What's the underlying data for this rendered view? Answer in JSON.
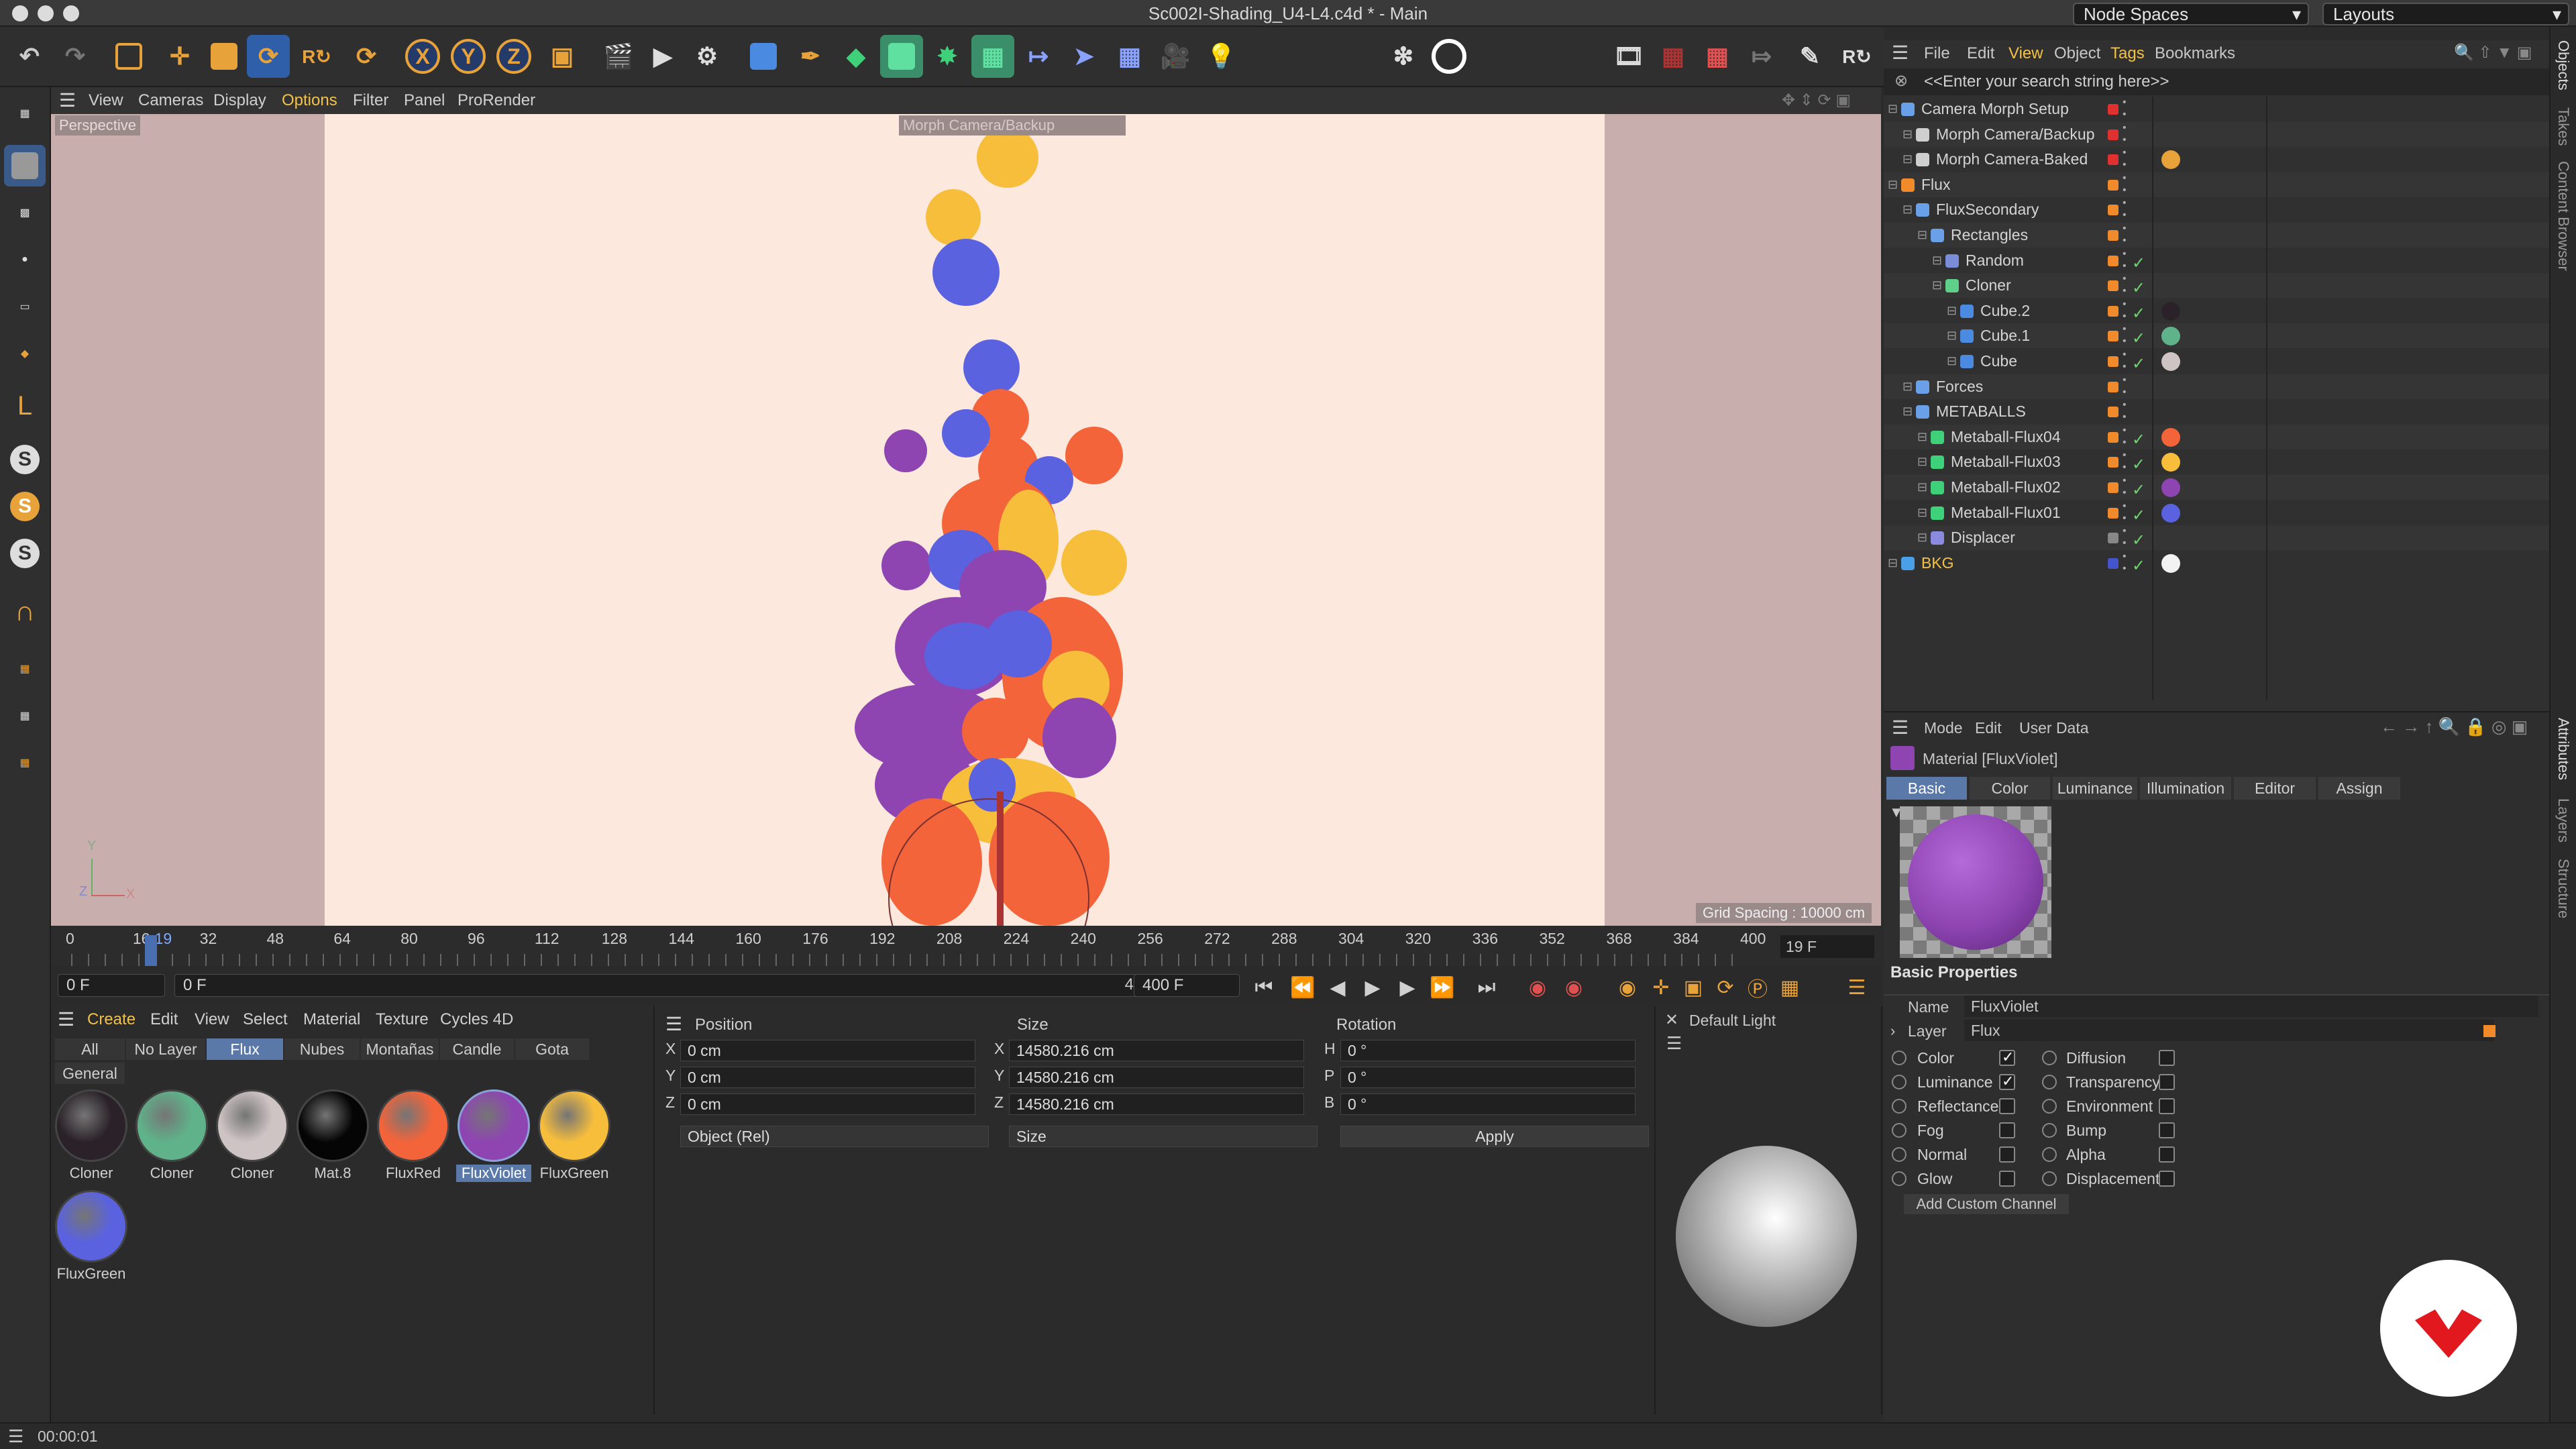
{
  "app": {
    "title": "Sc002I-Shading_U4-L4.c4d * - Main",
    "node_spaces": "Node Spaces",
    "layouts": "Layouts"
  },
  "viewport": {
    "menu": [
      "View",
      "Cameras",
      "Display",
      "Options",
      "Filter",
      "Panel",
      "ProRender"
    ],
    "active_menu": "Options",
    "label": "Perspective",
    "camera": "Morph Camera/Backup",
    "grid_spacing": "Grid Spacing : 10000 cm",
    "axis_x": "X",
    "axis_y": "Y",
    "axis_z": "Z"
  },
  "timeline": {
    "ticks": [
      "0",
      "16",
      "19",
      "32",
      "48",
      "64",
      "80",
      "96",
      "112",
      "128",
      "144",
      "160",
      "176",
      "192",
      "208",
      "224",
      "240",
      "256",
      "272",
      "288",
      "304",
      "320",
      "336",
      "352",
      "368",
      "384",
      "400"
    ],
    "current_frame": "19 F",
    "start": "0 F",
    "min": "0 F",
    "max": "400 F",
    "end": "400 F",
    "current_frame_value": 19,
    "max_frame_value": 400
  },
  "material_manager": {
    "menu": [
      "Create",
      "Edit",
      "View",
      "Select",
      "Material",
      "Texture",
      "Cycles 4D"
    ],
    "tabs": [
      "All",
      "No Layer",
      "Flux",
      "Nubes",
      "Montañas",
      "Candle",
      "Gota"
    ],
    "active_tab": "Flux",
    "subtab": "General",
    "materials": [
      {
        "name": "Cloner",
        "color": "#2a2228"
      },
      {
        "name": "Cloner",
        "color": "#5fb28a"
      },
      {
        "name": "Cloner",
        "color": "#cfc4c4"
      },
      {
        "name": "Mat.8",
        "color": "#050505"
      },
      {
        "name": "FluxRed",
        "color": "#f3643a"
      },
      {
        "name": "FluxViolet",
        "color": "#8e45b2"
      },
      {
        "name": "FluxGreen",
        "color": "#f7be3c"
      },
      {
        "name": "FluxGreen",
        "color": "#5a62e0"
      }
    ],
    "selected": "FluxViolet"
  },
  "coords": {
    "headers": {
      "position": "Position",
      "size": "Size",
      "rotation": "Rotation"
    },
    "rows": [
      {
        "axis": "X",
        "pos": "0 cm",
        "saxis": "X",
        "size": "14580.216 cm",
        "raxis": "H",
        "rot": "0 °"
      },
      {
        "axis": "Y",
        "pos": "0 cm",
        "saxis": "Y",
        "size": "14580.216 cm",
        "raxis": "P",
        "rot": "0 °"
      },
      {
        "axis": "Z",
        "pos": "0 cm",
        "saxis": "Z",
        "size": "14580.216 cm",
        "raxis": "B",
        "rot": "0 °"
      }
    ],
    "mode": "Object (Rel)",
    "size_mode": "Size",
    "apply": "Apply"
  },
  "light_preview": {
    "title": "Default Light"
  },
  "object_manager": {
    "menu": [
      "File",
      "Edit",
      "View",
      "Object",
      "Tags",
      "Bookmarks"
    ],
    "search_placeholder": "<<Enter your search string here>>",
    "objects": [
      {
        "name": "Camera Morph Setup",
        "indent": 0,
        "icon": "null-icon",
        "dot": "#e03030",
        "tags": []
      },
      {
        "name": "Morph Camera/Backup",
        "indent": 1,
        "icon": "camera-icon",
        "dot": "#e03030",
        "tags": []
      },
      {
        "name": "Morph Camera-Baked",
        "indent": 1,
        "icon": "camera-icon",
        "dot": "#e03030",
        "tags": [
          "#e8a23a"
        ]
      },
      {
        "name": "Flux",
        "indent": 0,
        "icon": "flux-icon",
        "dot": "#f08a2a",
        "tags": []
      },
      {
        "name": "FluxSecondary",
        "indent": 1,
        "icon": "null-icon",
        "dot": "#f08a2a",
        "tags": []
      },
      {
        "name": "Rectangles",
        "indent": 2,
        "icon": "null-icon",
        "dot": "#f08a2a",
        "tags": []
      },
      {
        "name": "Random",
        "indent": 3,
        "icon": "effector-icon",
        "dot": "#f08a2a",
        "tags": []
      },
      {
        "name": "Cloner",
        "indent": 3,
        "icon": "cloner-icon",
        "dot": "#f08a2a",
        "tags": []
      },
      {
        "name": "Cube.2",
        "indent": 4,
        "icon": "cube-icon",
        "dot": "#f08a2a",
        "tags": [
          "#2a2228"
        ]
      },
      {
        "name": "Cube.1",
        "indent": 4,
        "icon": "cube-icon",
        "dot": "#f08a2a",
        "tags": [
          "#5fb28a"
        ]
      },
      {
        "name": "Cube",
        "indent": 4,
        "icon": "cube-icon",
        "dot": "#f08a2a",
        "tags": [
          "#cfc4c4"
        ]
      },
      {
        "name": "Forces",
        "indent": 1,
        "icon": "null-icon",
        "dot": "#f08a2a",
        "tags": []
      },
      {
        "name": "METABALLS",
        "indent": 1,
        "icon": "null-icon",
        "dot": "#f08a2a",
        "tags": []
      },
      {
        "name": "Metaball-Flux04",
        "indent": 2,
        "icon": "metaball-icon",
        "dot": "#f08a2a",
        "tags": [
          "#f3643a"
        ]
      },
      {
        "name": "Metaball-Flux03",
        "indent": 2,
        "icon": "metaball-icon",
        "dot": "#f08a2a",
        "tags": [
          "#f7be3c"
        ]
      },
      {
        "name": "Metaball-Flux02",
        "indent": 2,
        "icon": "metaball-icon",
        "dot": "#f08a2a",
        "tags": [
          "#8e45b2"
        ]
      },
      {
        "name": "Metaball-Flux01",
        "indent": 2,
        "icon": "metaball-icon",
        "dot": "#f08a2a",
        "tags": [
          "#5a62e0"
        ]
      },
      {
        "name": "Displacer",
        "indent": 2,
        "icon": "deformer-icon",
        "dot": "#888888",
        "tags": []
      },
      {
        "name": "BKG",
        "indent": 0,
        "icon": "background-icon",
        "dot": "#4455cc",
        "tags": [
          "#f2f2f2"
        ]
      }
    ]
  },
  "attributes": {
    "menu": [
      "Mode",
      "Edit",
      "User Data"
    ],
    "title": "Material [FluxViolet]",
    "tabs": [
      "Basic",
      "Color",
      "Luminance",
      "Illumination",
      "Editor",
      "Assign"
    ],
    "active_tab": "Basic",
    "section": "Basic Properties",
    "name_label": "Name",
    "name_value": "FluxViolet",
    "layer_label": "Layer",
    "layer_value": "Flux",
    "channels_left": [
      {
        "label": "Color",
        "on": true
      },
      {
        "label": "Luminance",
        "on": true
      },
      {
        "label": "Reflectance",
        "on": false
      },
      {
        "label": "Fog",
        "on": false
      },
      {
        "label": "Normal",
        "on": false
      },
      {
        "label": "Glow",
        "on": false
      }
    ],
    "channels_right": [
      {
        "label": "Diffusion",
        "on": false
      },
      {
        "label": "Transparency",
        "on": false
      },
      {
        "label": "Environment",
        "on": false
      },
      {
        "label": "Bump",
        "on": false
      },
      {
        "label": "Alpha",
        "on": false
      },
      {
        "label": "Displacement",
        "on": false
      }
    ],
    "add_channel": "Add Custom Channel"
  },
  "side_tabs": [
    "Objects",
    "Takes",
    "Content Browser",
    "Attributes",
    "Layers",
    "Structure"
  ],
  "status": {
    "time": "00:00:01"
  }
}
